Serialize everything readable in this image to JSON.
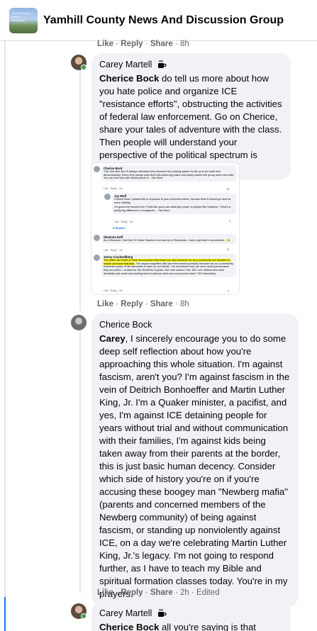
{
  "header": {
    "title": "Yamhill County News And Discussion Group",
    "thumb_text": "Yamhill County News & Discussion"
  },
  "top_meta": {
    "like": "Like",
    "reply": "Reply",
    "share": "Share",
    "time": "8h"
  },
  "comment1": {
    "author": "Carey Martell",
    "author_icon": "coffee-cup-icon",
    "mention": "Cherice Bock",
    "text": " do tell us more about how you hate police and organize ICE \"resistance efforts\", obstructing the activities of federal law enforcement. Go on Cherice, share your tales of adventure with the class. Then people will understand your perspective of the political spectrum is severely distorted.",
    "meta": {
      "like": "Like",
      "reply": "Reply",
      "share": "Share",
      "time": "8h"
    }
  },
  "screenshot": {
    "c1": {
      "name": "Cherice Bock",
      "text": "Y'all, thin blue line IS always anti-black lives because the policing system is set up to be racist and dehumanizing. Every time people post stuff both-sides-ing police and equity makes this group seem less safe. You can love and care about police of... See More",
      "meta": "Like · Reply · 3w",
      "react": "16"
    },
    "c2": {
      "name": "Jay Wolf",
      "text": "Cherice Bock I posted this in response to your comment earlier, but also think it should go here for more visibility.",
      "text2": "I'm gonna be honest here. Posts like yours are what give power to people like Shannon. There's a pretty big difference in recognized ... See More",
      "meta": "Like · Reply · 3w",
      "react": "5"
    },
    "replies_link": "5 Replies",
    "c3": {
      "name": "Shannon Eoff",
      "text": "As a Shannon, I feel like VC Brian Shannon is a bad rep of Shannons. I had to get that in somewhere... 😉",
      "meta": "Like · Reply · 3w",
      "react": "12"
    },
    "c4": {
      "name": "Jenny Cracknellberg",
      "highlight": "The police are racist or have unconscious bias based on race because we as a community are founded on racism and have that bias.",
      "text": " The impact magnifies with law enforcement precisely because we as a community invest the power of life and death in them on our behalf. I do not believe they are more racist just because they are police. I worked for the Sheriff for 8 years. Did I see racism? Yes. Did I see officers who were decidedly anti-racist and working hard to address their own unconscious bias? YES absolutely.",
      "meta": "Like · Reply · 3w",
      "react": "3"
    }
  },
  "shot_meta": {
    "like": "Like",
    "reply": "Reply",
    "share": "Share",
    "time": "8h"
  },
  "comment2": {
    "author": "Cherice Bock",
    "mention": "Carey",
    "text": ", I sincerely encourage you to do some deep self reflection about how you're approaching this whole situation. I'm against fascism, aren't you? I'm against fascism in the vein of Deitrich Bonhoeffer and Martin Luther King, Jr. I'm a Quaker minister, a pacifist, and yes, I'm against ICE detaining people for years without trial and without communication with their families, I'm against kids being taken away from their parents at the border, this is just basic human decency. Consider which side of history you're on if you're accusing these boogey man \"Newberg mafia\" (parents and concerned members of the Newberg community) of being against fascism, or standing up nonviolently against ICE, on a day we're celebrating Martin Luther King, Jr.'s legacy. I'm not going to respond further, as I have to teach my Bible and spiritual formation classes today. You're in my prayers.",
    "meta": {
      "like": "Like",
      "reply": "Reply",
      "share": "Share",
      "time": "2h",
      "edited": "Edited"
    }
  },
  "comment3": {
    "author": "Carey Martell",
    "author_icon": "coffee-cup-icon",
    "mention": "Cherice Bock",
    "text": " all you're saying is that you're"
  }
}
